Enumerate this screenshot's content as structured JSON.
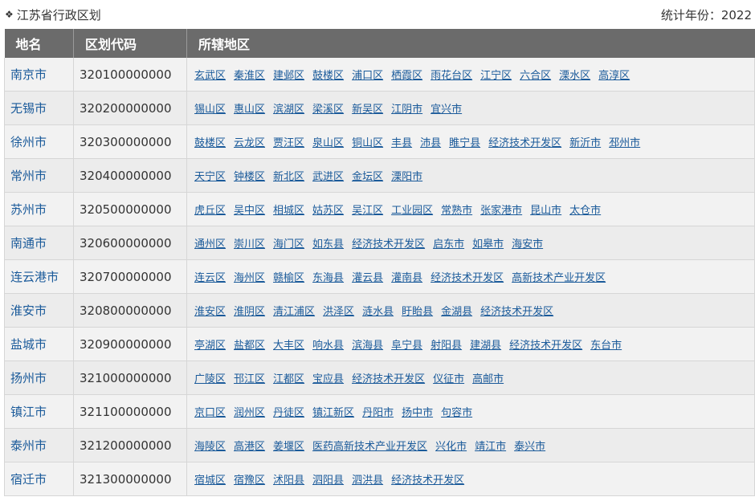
{
  "header": {
    "title": "江苏省行政区划",
    "stat_year": "统计年份：2022"
  },
  "table": {
    "columns": [
      "地名",
      "区划代码",
      "所辖地区"
    ],
    "rows": [
      {
        "name": "南京市",
        "code": "320100000000",
        "subs": [
          "玄武区",
          "秦淮区",
          "建邺区",
          "鼓楼区",
          "浦口区",
          "栖霞区",
          "雨花台区",
          "江宁区",
          "六合区",
          "溧水区",
          "高淳区"
        ]
      },
      {
        "name": "无锡市",
        "code": "320200000000",
        "subs": [
          "锡山区",
          "惠山区",
          "滨湖区",
          "梁溪区",
          "新吴区",
          "江阴市",
          "宜兴市"
        ]
      },
      {
        "name": "徐州市",
        "code": "320300000000",
        "subs": [
          "鼓楼区",
          "云龙区",
          "贾汪区",
          "泉山区",
          "铜山区",
          "丰县",
          "沛县",
          "睢宁县",
          "经济技术开发区",
          "新沂市",
          "邳州市"
        ]
      },
      {
        "name": "常州市",
        "code": "320400000000",
        "subs": [
          "天宁区",
          "钟楼区",
          "新北区",
          "武进区",
          "金坛区",
          "溧阳市"
        ]
      },
      {
        "name": "苏州市",
        "code": "320500000000",
        "subs": [
          "虎丘区",
          "吴中区",
          "相城区",
          "姑苏区",
          "吴江区",
          "工业园区",
          "常熟市",
          "张家港市",
          "昆山市",
          "太仓市"
        ]
      },
      {
        "name": "南通市",
        "code": "320600000000",
        "subs": [
          "通州区",
          "崇川区",
          "海门区",
          "如东县",
          "经济技术开发区",
          "启东市",
          "如皋市",
          "海安市"
        ]
      },
      {
        "name": "连云港市",
        "code": "320700000000",
        "subs": [
          "连云区",
          "海州区",
          "赣榆区",
          "东海县",
          "灌云县",
          "灌南县",
          "经济技术开发区",
          "高新技术产业开发区"
        ]
      },
      {
        "name": "淮安市",
        "code": "320800000000",
        "subs": [
          "淮安区",
          "淮阴区",
          "清江浦区",
          "洪泽区",
          "涟水县",
          "盱眙县",
          "金湖县",
          "经济技术开发区"
        ]
      },
      {
        "name": "盐城市",
        "code": "320900000000",
        "subs": [
          "亭湖区",
          "盐都区",
          "大丰区",
          "响水县",
          "滨海县",
          "阜宁县",
          "射阳县",
          "建湖县",
          "经济技术开发区",
          "东台市"
        ]
      },
      {
        "name": "扬州市",
        "code": "321000000000",
        "subs": [
          "广陵区",
          "邗江区",
          "江都区",
          "宝应县",
          "经济技术开发区",
          "仪征市",
          "高邮市"
        ]
      },
      {
        "name": "镇江市",
        "code": "321100000000",
        "subs": [
          "京口区",
          "润州区",
          "丹徒区",
          "镇江新区",
          "丹阳市",
          "扬中市",
          "句容市"
        ]
      },
      {
        "name": "泰州市",
        "code": "321200000000",
        "subs": [
          "海陵区",
          "高港区",
          "姜堰区",
          "医药高新技术产业开发区",
          "兴化市",
          "靖江市",
          "泰兴市"
        ]
      },
      {
        "name": "宿迁市",
        "code": "321300000000",
        "subs": [
          "宿城区",
          "宿豫区",
          "沭阳县",
          "泗阳县",
          "泗洪县",
          "经济技术开发区"
        ]
      }
    ]
  }
}
